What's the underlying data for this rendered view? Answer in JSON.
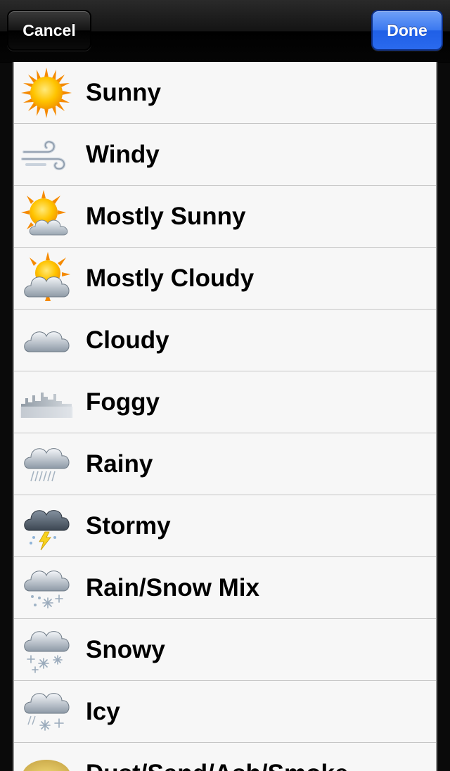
{
  "toolbar": {
    "cancel_label": "Cancel",
    "done_label": "Done"
  },
  "conditions": [
    {
      "label": "Sunny",
      "icon": "sun-icon"
    },
    {
      "label": "Windy",
      "icon": "wind-icon"
    },
    {
      "label": "Mostly Sunny",
      "icon": "sun-cloud-icon"
    },
    {
      "label": "Mostly Cloudy",
      "icon": "cloud-sun-icon"
    },
    {
      "label": "Cloudy",
      "icon": "cloud-icon"
    },
    {
      "label": "Foggy",
      "icon": "fog-icon"
    },
    {
      "label": "Rainy",
      "icon": "rain-icon"
    },
    {
      "label": "Stormy",
      "icon": "storm-icon"
    },
    {
      "label": "Rain/Snow Mix",
      "icon": "rain-snow-icon"
    },
    {
      "label": "Snowy",
      "icon": "snow-icon"
    },
    {
      "label": "Icy",
      "icon": "ice-icon"
    },
    {
      "label": "Dust/Sand/Ash/Smoke",
      "icon": "dust-icon"
    }
  ],
  "colors": {
    "done_accent": "#2a6aee",
    "list_background": "#f7f7f7",
    "toolbar_background": "#0a0a0a"
  }
}
